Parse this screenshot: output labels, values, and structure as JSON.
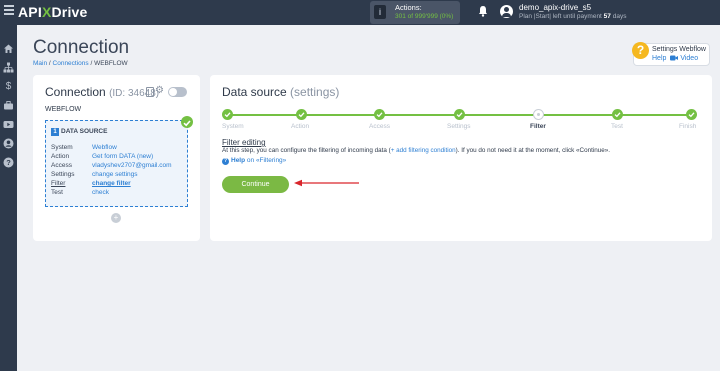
{
  "topbar": {
    "logo_pre": "API",
    "logo_x": "X",
    "logo_post": "Drive",
    "actions_label": "Actions:",
    "actions_value": "301 of 999'999 (0%)",
    "username": "demo_apix-drive_s5",
    "plan_pre": "Plan |Start| left until payment ",
    "plan_days": "57",
    "plan_post": " days"
  },
  "sidebar": {
    "icons": [
      "home-icon",
      "sitemap-icon",
      "dollar-icon",
      "briefcase-icon",
      "video-icon",
      "user-icon",
      "help-icon"
    ]
  },
  "header": {
    "title": "Connection",
    "breadcrumb": {
      "main": "Main",
      "sep1": " / ",
      "connections": "Connections",
      "sep2": " / ",
      "current": "WEBFLOW"
    }
  },
  "help_widget": {
    "icon": "?",
    "title": "Settings Webflow",
    "help": "Help",
    "video": "Video"
  },
  "connection": {
    "title": "Connection",
    "id": "(ID: 34648)",
    "name": "WEBFLOW",
    "data_source": {
      "num": "1",
      "heading": "DATA SOURCE",
      "rows": [
        {
          "k": "System",
          "v": "Webflow"
        },
        {
          "k": "Action",
          "v": "Get form DATA (new)"
        },
        {
          "k": "Access",
          "v": "vladyshev2707@gmail.com"
        },
        {
          "k": "Settings",
          "v": "change settings"
        },
        {
          "k": "Filter",
          "v": "change filter"
        },
        {
          "k": "Test",
          "v": "check"
        }
      ]
    },
    "add": "+"
  },
  "datasource": {
    "title": "Data source",
    "subtitle": "(settings)",
    "steps": [
      "System",
      "Action",
      "Access",
      "Settings",
      "Filter",
      "Test",
      "Finish"
    ],
    "current_step": "Filter",
    "filter_title": "Filter editing",
    "filter_text_pre": "At this step, you can configure the filtering of incoming data (",
    "filter_text_link": "+ add filtering condition",
    "filter_text_post": "). If you do not need it at the moment, click «Continue».",
    "help_icon": "?",
    "help_pre": "Help",
    "help_on": " on ",
    "help_link": "«Filtering»",
    "continue_label": "Continue"
  },
  "colors": {
    "topbar": "#2e3a4c",
    "accent_green": "#74c043",
    "link_blue": "#2d7fd3",
    "arrow_red": "#d9262c"
  }
}
